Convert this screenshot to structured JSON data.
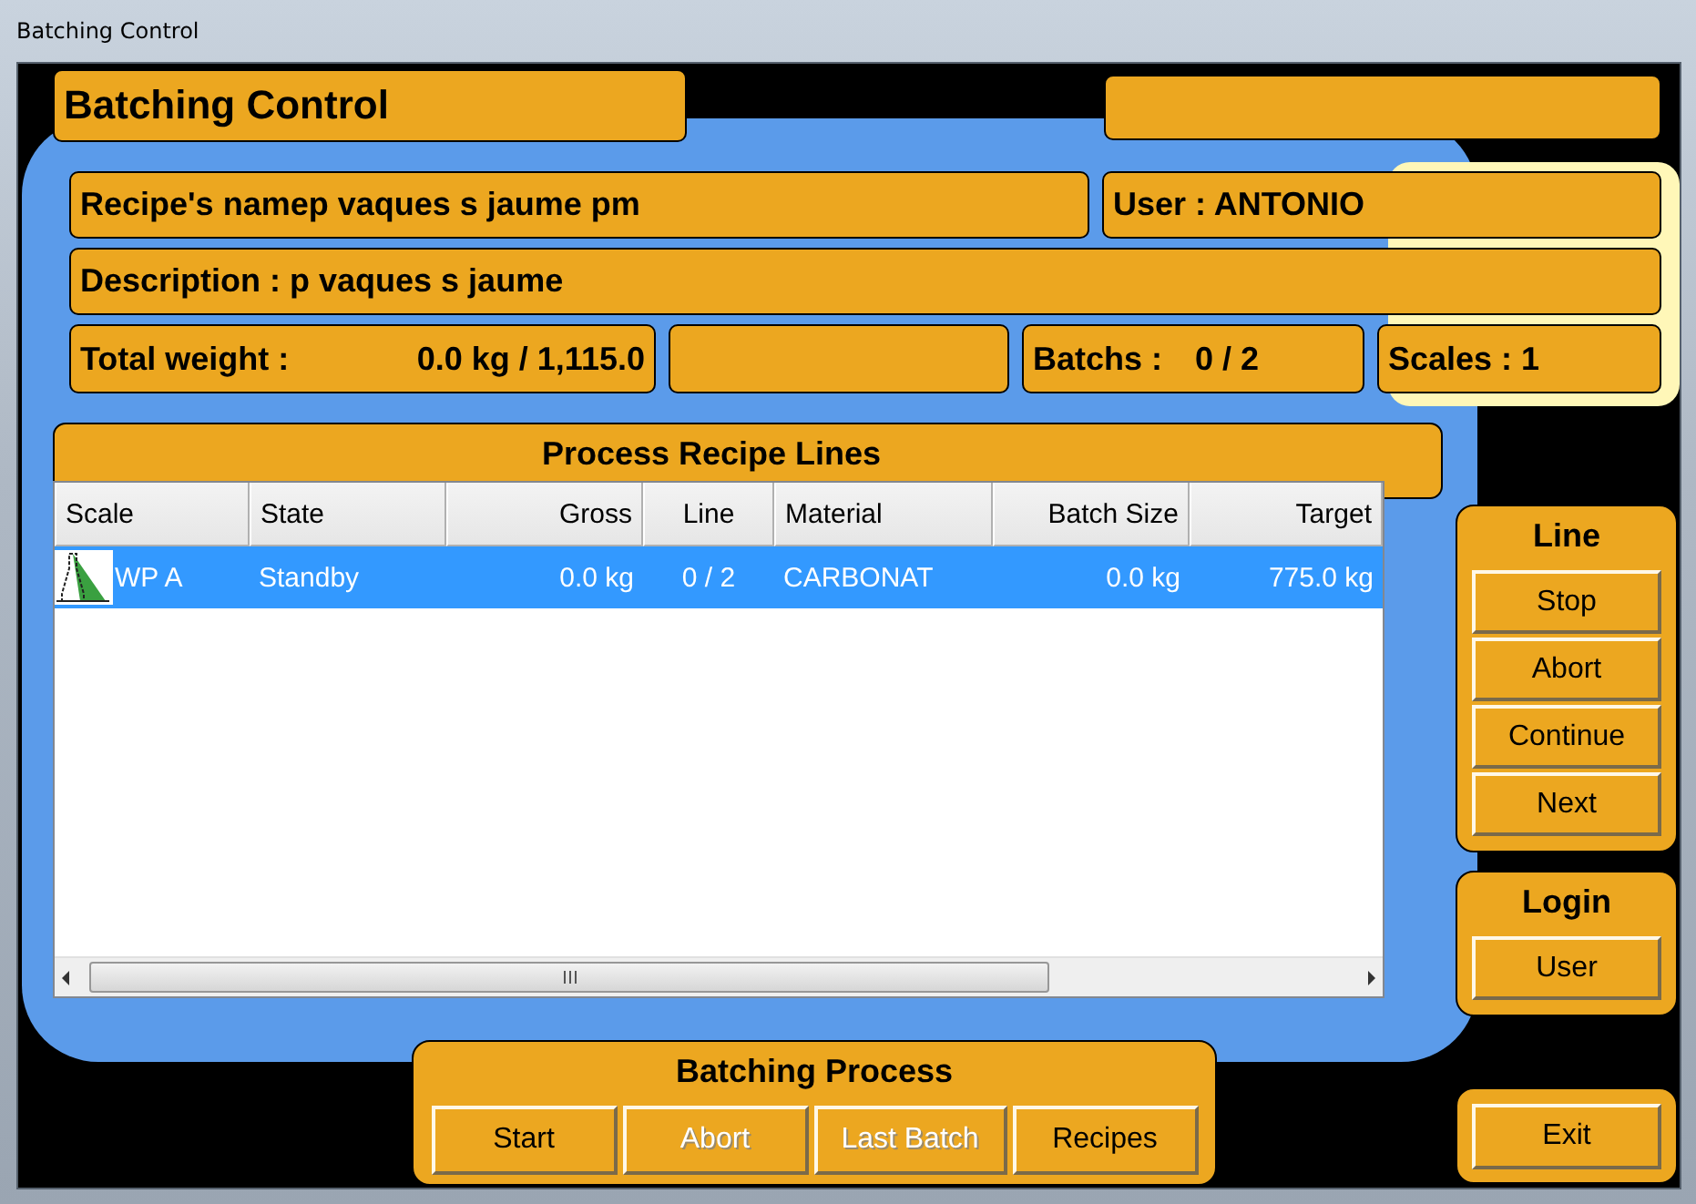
{
  "window": {
    "title": "Batching Control"
  },
  "header": {
    "title": "Batching Control"
  },
  "info": {
    "recipe_name": "Recipe's namep vaques s jaume pm",
    "user": "User : ANTONIO",
    "description": "Description : p vaques s jaume",
    "total_weight_label": "Total weight :",
    "total_weight_value": "0.0 kg / 1,115.0",
    "batchs_label": "Batchs :",
    "batchs_value": "0 / 2",
    "scales": "Scales : 1"
  },
  "table": {
    "title": "Process Recipe Lines",
    "columns": [
      {
        "label": "Scale",
        "kind": "text"
      },
      {
        "label": "State",
        "kind": "text"
      },
      {
        "label": "Gross",
        "kind": "quantity"
      },
      {
        "label": "Line",
        "kind": "ratio"
      },
      {
        "label": "Material",
        "kind": "text"
      },
      {
        "label": "Batch Size",
        "kind": "quantity"
      },
      {
        "label": "Target",
        "kind": "quantity"
      }
    ],
    "rows": [
      {
        "selected": true,
        "cells": [
          "WP A",
          "Standby",
          "0.0 kg",
          "0 / 2",
          "CARBONAT",
          "0.0 kg",
          "775.0 kg"
        ]
      }
    ]
  },
  "line_panel": {
    "title": "Line",
    "buttons": [
      {
        "label": "Stop",
        "disabled": false
      },
      {
        "label": "Abort",
        "disabled": false
      },
      {
        "label": "Continue",
        "disabled": false
      },
      {
        "label": "Next",
        "disabled": false
      }
    ]
  },
  "login_panel": {
    "title": "Login",
    "buttons": [
      {
        "label": "User",
        "disabled": false
      }
    ]
  },
  "batching_panel": {
    "title": "Batching Process",
    "buttons": [
      {
        "label": "Start",
        "disabled": false
      },
      {
        "label": "Abort",
        "disabled": true
      },
      {
        "label": "Last Batch",
        "disabled": true
      },
      {
        "label": "Recipes",
        "disabled": false
      }
    ]
  },
  "exit_panel": {
    "buttons": [
      {
        "label": "Exit",
        "disabled": false
      }
    ]
  }
}
